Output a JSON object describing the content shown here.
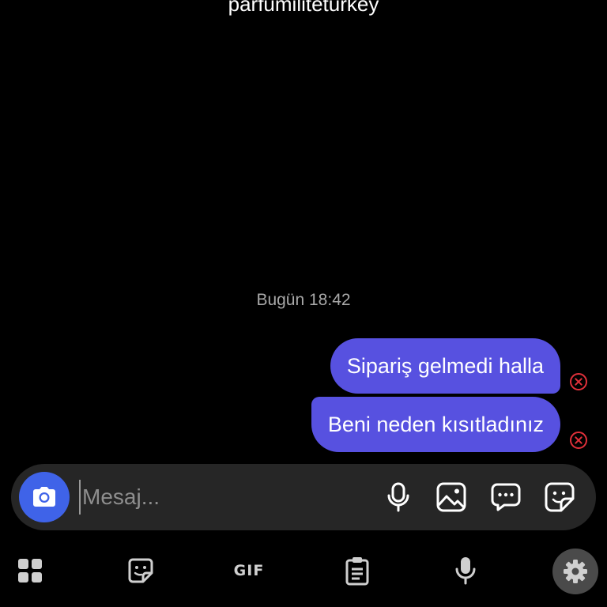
{
  "header": {
    "username": "parfumiliteturkey"
  },
  "conversation": {
    "timestamp": "Bugün 18:42",
    "messages": [
      {
        "text": "Sipariş gelmedi halla",
        "status": "failed"
      },
      {
        "text": "Beni neden kısıtladınız",
        "status": "failed"
      }
    ]
  },
  "composer": {
    "placeholder": "Mesaj...",
    "value": "",
    "icons": [
      "camera-icon",
      "microphone-icon",
      "gallery-icon",
      "chat-bubble-icon",
      "sticker-icon"
    ]
  },
  "keyboard_toolbar": {
    "gif_label": "GIF",
    "icons": [
      "apps-grid-icon",
      "sticker-icon",
      "gif-icon",
      "clipboard-icon",
      "voice-input-icon",
      "settings-icon"
    ]
  },
  "colors": {
    "background": "#000000",
    "bubble": "#5751e0",
    "composer": "#262626",
    "camera_button": "#3f63e8",
    "error": "#e0303a",
    "icon": "#ffffff",
    "keyboard_icon": "#cfcfcf"
  }
}
